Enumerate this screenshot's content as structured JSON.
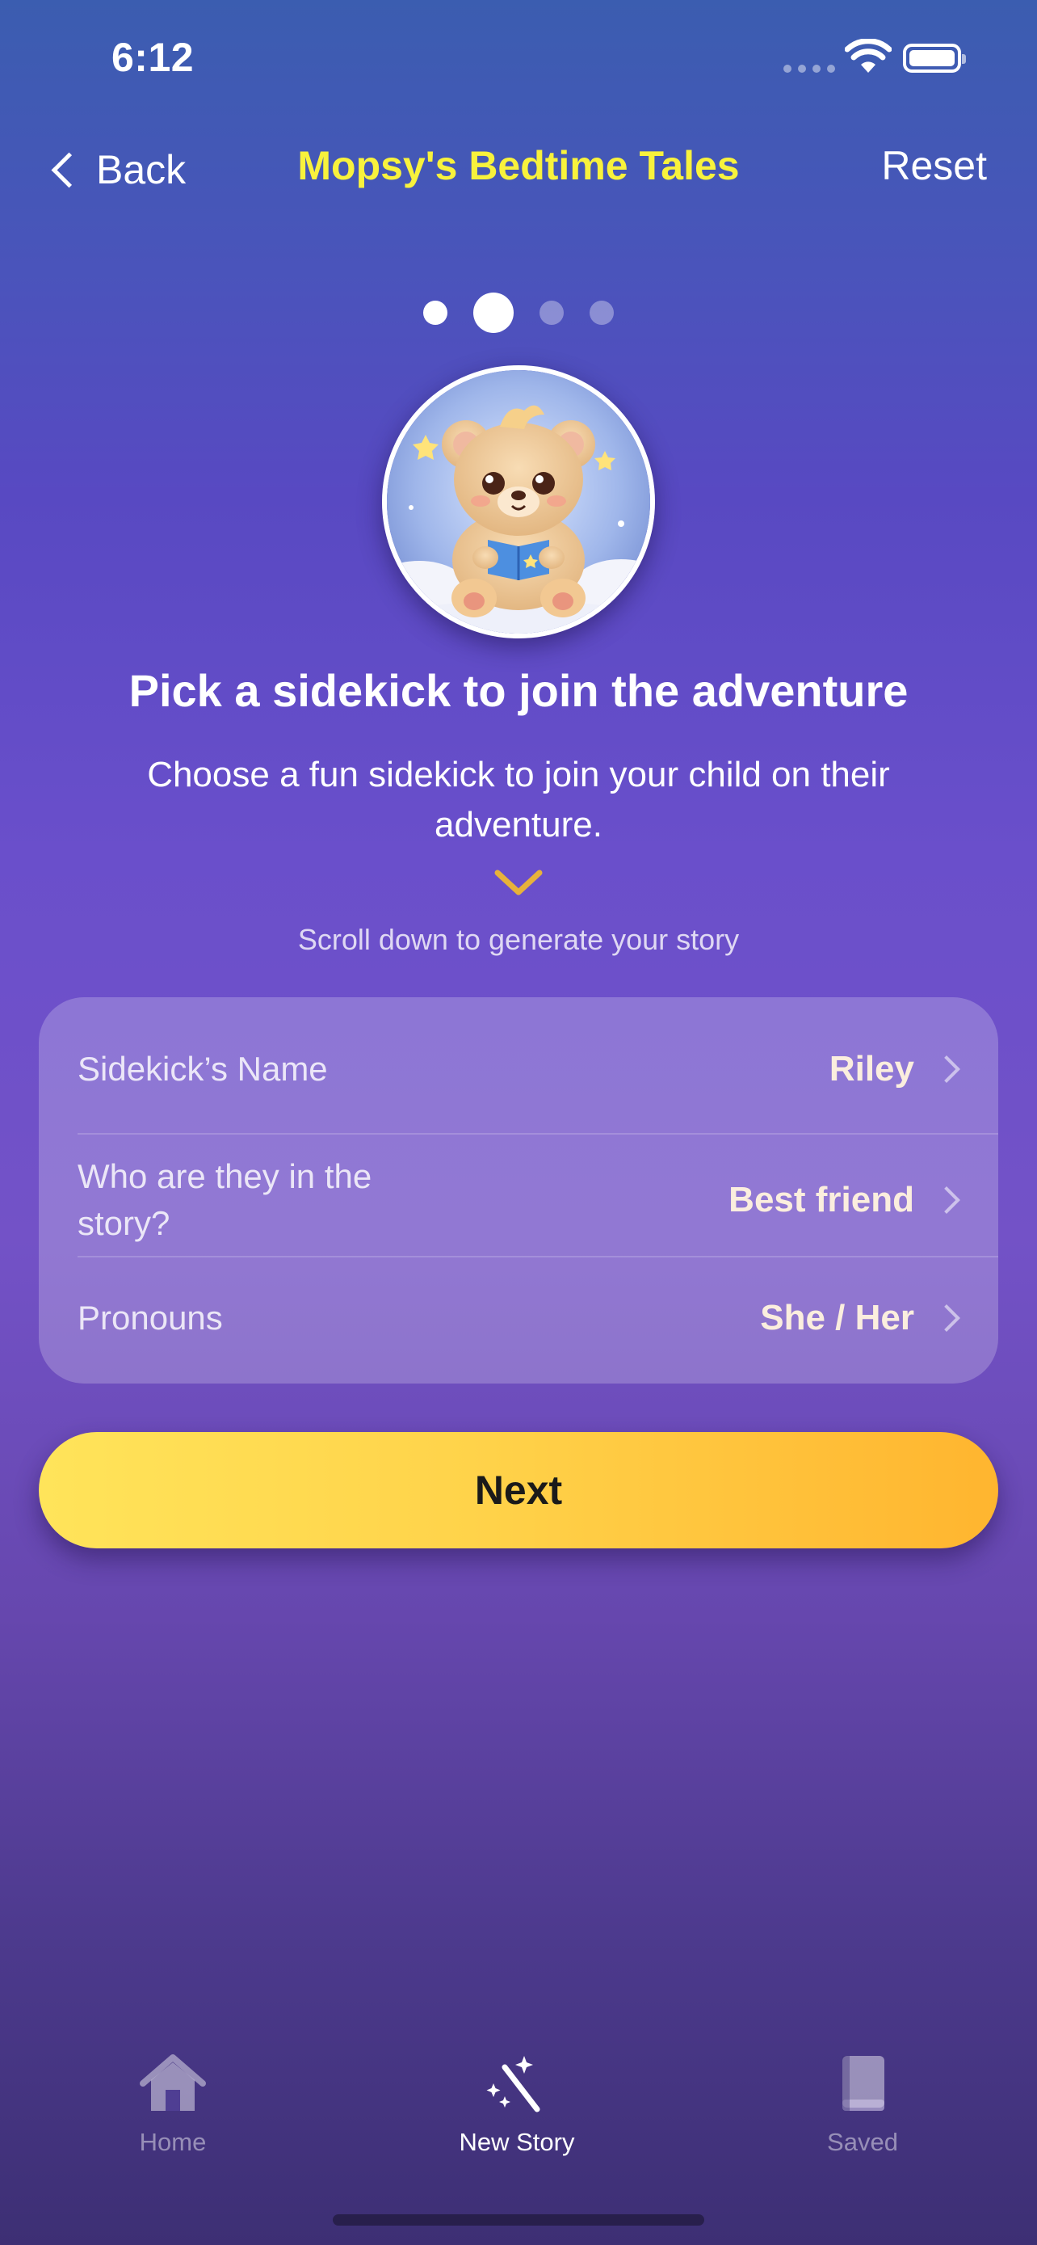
{
  "status_bar": {
    "time": "6:12"
  },
  "nav": {
    "back_label": "Back",
    "title": "Mopsy's Bedtime Tales",
    "reset_label": "Reset"
  },
  "progress": {
    "total_steps": 4,
    "current_step": 2
  },
  "hero": {
    "headline": "Pick a sidekick to join the adventure",
    "subhead": "Choose a fun sidekick to join your child on their adventure.",
    "scroll_hint": "Scroll down to generate your story"
  },
  "form": {
    "rows": [
      {
        "label": "Sidekick’s Name",
        "value": "Riley"
      },
      {
        "label": "Who are they in the story?",
        "value": "Best friend"
      },
      {
        "label": "Pronouns",
        "value": "She / Her"
      }
    ]
  },
  "next_button": {
    "label": "Next"
  },
  "tab_bar": {
    "tabs": [
      {
        "label": "Home",
        "icon": "home-icon",
        "active": false
      },
      {
        "label": "New Story",
        "icon": "magic-wand-icon",
        "active": true
      },
      {
        "label": "Saved",
        "icon": "book-icon",
        "active": false
      }
    ]
  },
  "colors": {
    "title_yellow": "#f8f23c",
    "button_gradient_start": "#ffe45a",
    "button_gradient_end": "#ffb52f",
    "chevron_gold": "#e8b23a"
  }
}
